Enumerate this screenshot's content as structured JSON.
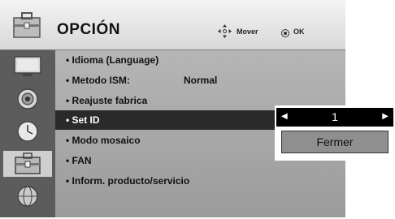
{
  "header": {
    "title": "OPCIÓN",
    "mover_label": "Mover",
    "ok_label": "OK"
  },
  "sidebar": {
    "items": [
      {
        "icon": "tv-icon"
      },
      {
        "icon": "speaker-icon"
      },
      {
        "icon": "clock-icon"
      },
      {
        "icon": "toolbox-icon",
        "selected": true
      },
      {
        "icon": "globe-icon"
      }
    ]
  },
  "menu": {
    "items": [
      {
        "label": "• Idioma (Language)"
      },
      {
        "label": "• Metodo ISM:",
        "value": "Normal"
      },
      {
        "label": "• Reajuste fabrica"
      },
      {
        "label": "• Set ID",
        "active": true
      },
      {
        "label": "• Modo mosaico"
      },
      {
        "label": "• FAN"
      },
      {
        "label": "• Inform. producto/servicio"
      }
    ]
  },
  "popup": {
    "set_id_value": "1",
    "close_label": "Fermer"
  },
  "colors": {
    "highlight": "#2a2a2a",
    "panel": "#a8a8a8",
    "sidebar": "#5c5c5c"
  }
}
